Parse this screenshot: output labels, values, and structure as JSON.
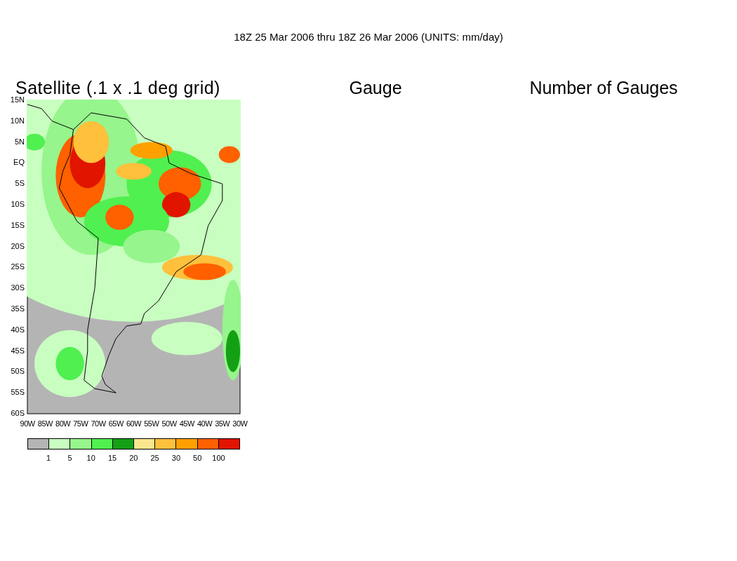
{
  "title": "18Z 25 Mar 2006 thru 18Z 26 Mar 2006 (UNITS: mm/day)",
  "panels": [
    {
      "title": "Satellite (.1 x .1 deg grid)",
      "kind": "map",
      "lat_labels": [
        "15N",
        "10N",
        "5N",
        "EQ",
        "5S",
        "10S",
        "15S",
        "20S",
        "25S",
        "30S",
        "35S",
        "40S",
        "45S",
        "50S",
        "55S",
        "60S"
      ],
      "lon_labels": [
        "90W",
        "85W",
        "80W",
        "75W",
        "70W",
        "65W",
        "60W",
        "55W",
        "50W",
        "45W",
        "40W",
        "35W",
        "30W"
      ],
      "colorbar": {
        "bins": [
          {
            "color": "#b4b4b4"
          },
          {
            "color": "#c8ffc0"
          },
          {
            "color": "#96f58c"
          },
          {
            "color": "#50f050"
          },
          {
            "color": "#14a014"
          },
          {
            "color": "#fae68c"
          },
          {
            "color": "#ffc03c"
          },
          {
            "color": "#ffa000"
          },
          {
            "color": "#ff6000"
          },
          {
            "color": "#e11400"
          }
        ],
        "labels": [
          "1",
          "5",
          "10",
          "15",
          "20",
          "25",
          "30",
          "50",
          "100"
        ]
      }
    },
    {
      "title": "Gauge",
      "kind": "empty"
    },
    {
      "title": "Number of Gauges",
      "kind": "empty"
    }
  ]
}
